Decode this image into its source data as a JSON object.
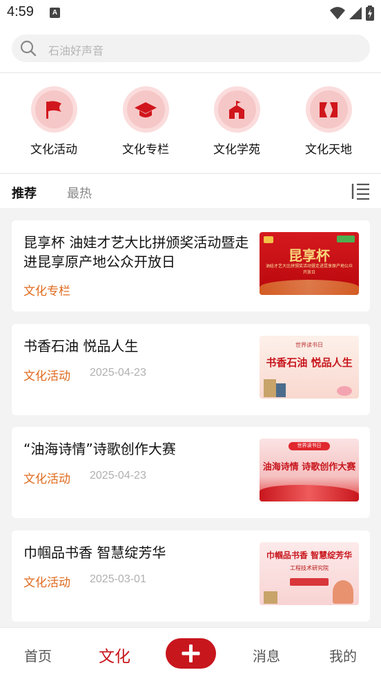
{
  "status_bar": {
    "time": "4:59",
    "notification_letter": "A"
  },
  "search": {
    "placeholder": "石油好声音"
  },
  "categories": [
    {
      "label": "文化活动",
      "icon": "flag-icon"
    },
    {
      "label": "文化专栏",
      "icon": "graduation-cap-icon"
    },
    {
      "label": "文化学苑",
      "icon": "school-building-icon"
    },
    {
      "label": "文化天地",
      "icon": "open-book-icon"
    }
  ],
  "tabs": [
    {
      "label": "推荐",
      "active": true
    },
    {
      "label": "最热",
      "active": false
    }
  ],
  "feed": [
    {
      "title": "昆享杯 油娃才艺大比拼颁奖活动暨走进昆享原产地公众开放日",
      "category": "文化专栏",
      "date": "",
      "thumb_text": "昆享杯",
      "thumb_subtext": "油娃才艺大比拼颁奖活动暨走进昆享原产地公众开放日"
    },
    {
      "title": "书香石油 悦品人生",
      "category": "文化活动",
      "date": "2025-04-23",
      "thumb_text": "书香石油 悦品人生",
      "thumb_subtext": "世界读书日"
    },
    {
      "title": "“油海诗情”诗歌创作大赛",
      "category": "文化活动",
      "date": "2025-04-23",
      "thumb_text": "油海诗情 诗歌创作大赛",
      "thumb_subtext": "世界读书日"
    },
    {
      "title": "巾帼品书香 智慧绽芳华",
      "category": "文化活动",
      "date": "2025-03-01",
      "thumb_text": "巾帼品书香 智慧绽芳华",
      "thumb_subtext": "工程技术研究院"
    }
  ],
  "bottom_nav": [
    {
      "label": "首页",
      "active": false
    },
    {
      "label": "文化",
      "active": true
    },
    {
      "label": "消息",
      "active": false
    },
    {
      "label": "我的",
      "active": false
    }
  ],
  "colors": {
    "brand_red": "#c8161d",
    "category_orange": "#e06a1d",
    "date_gray": "#b0b0b0"
  }
}
